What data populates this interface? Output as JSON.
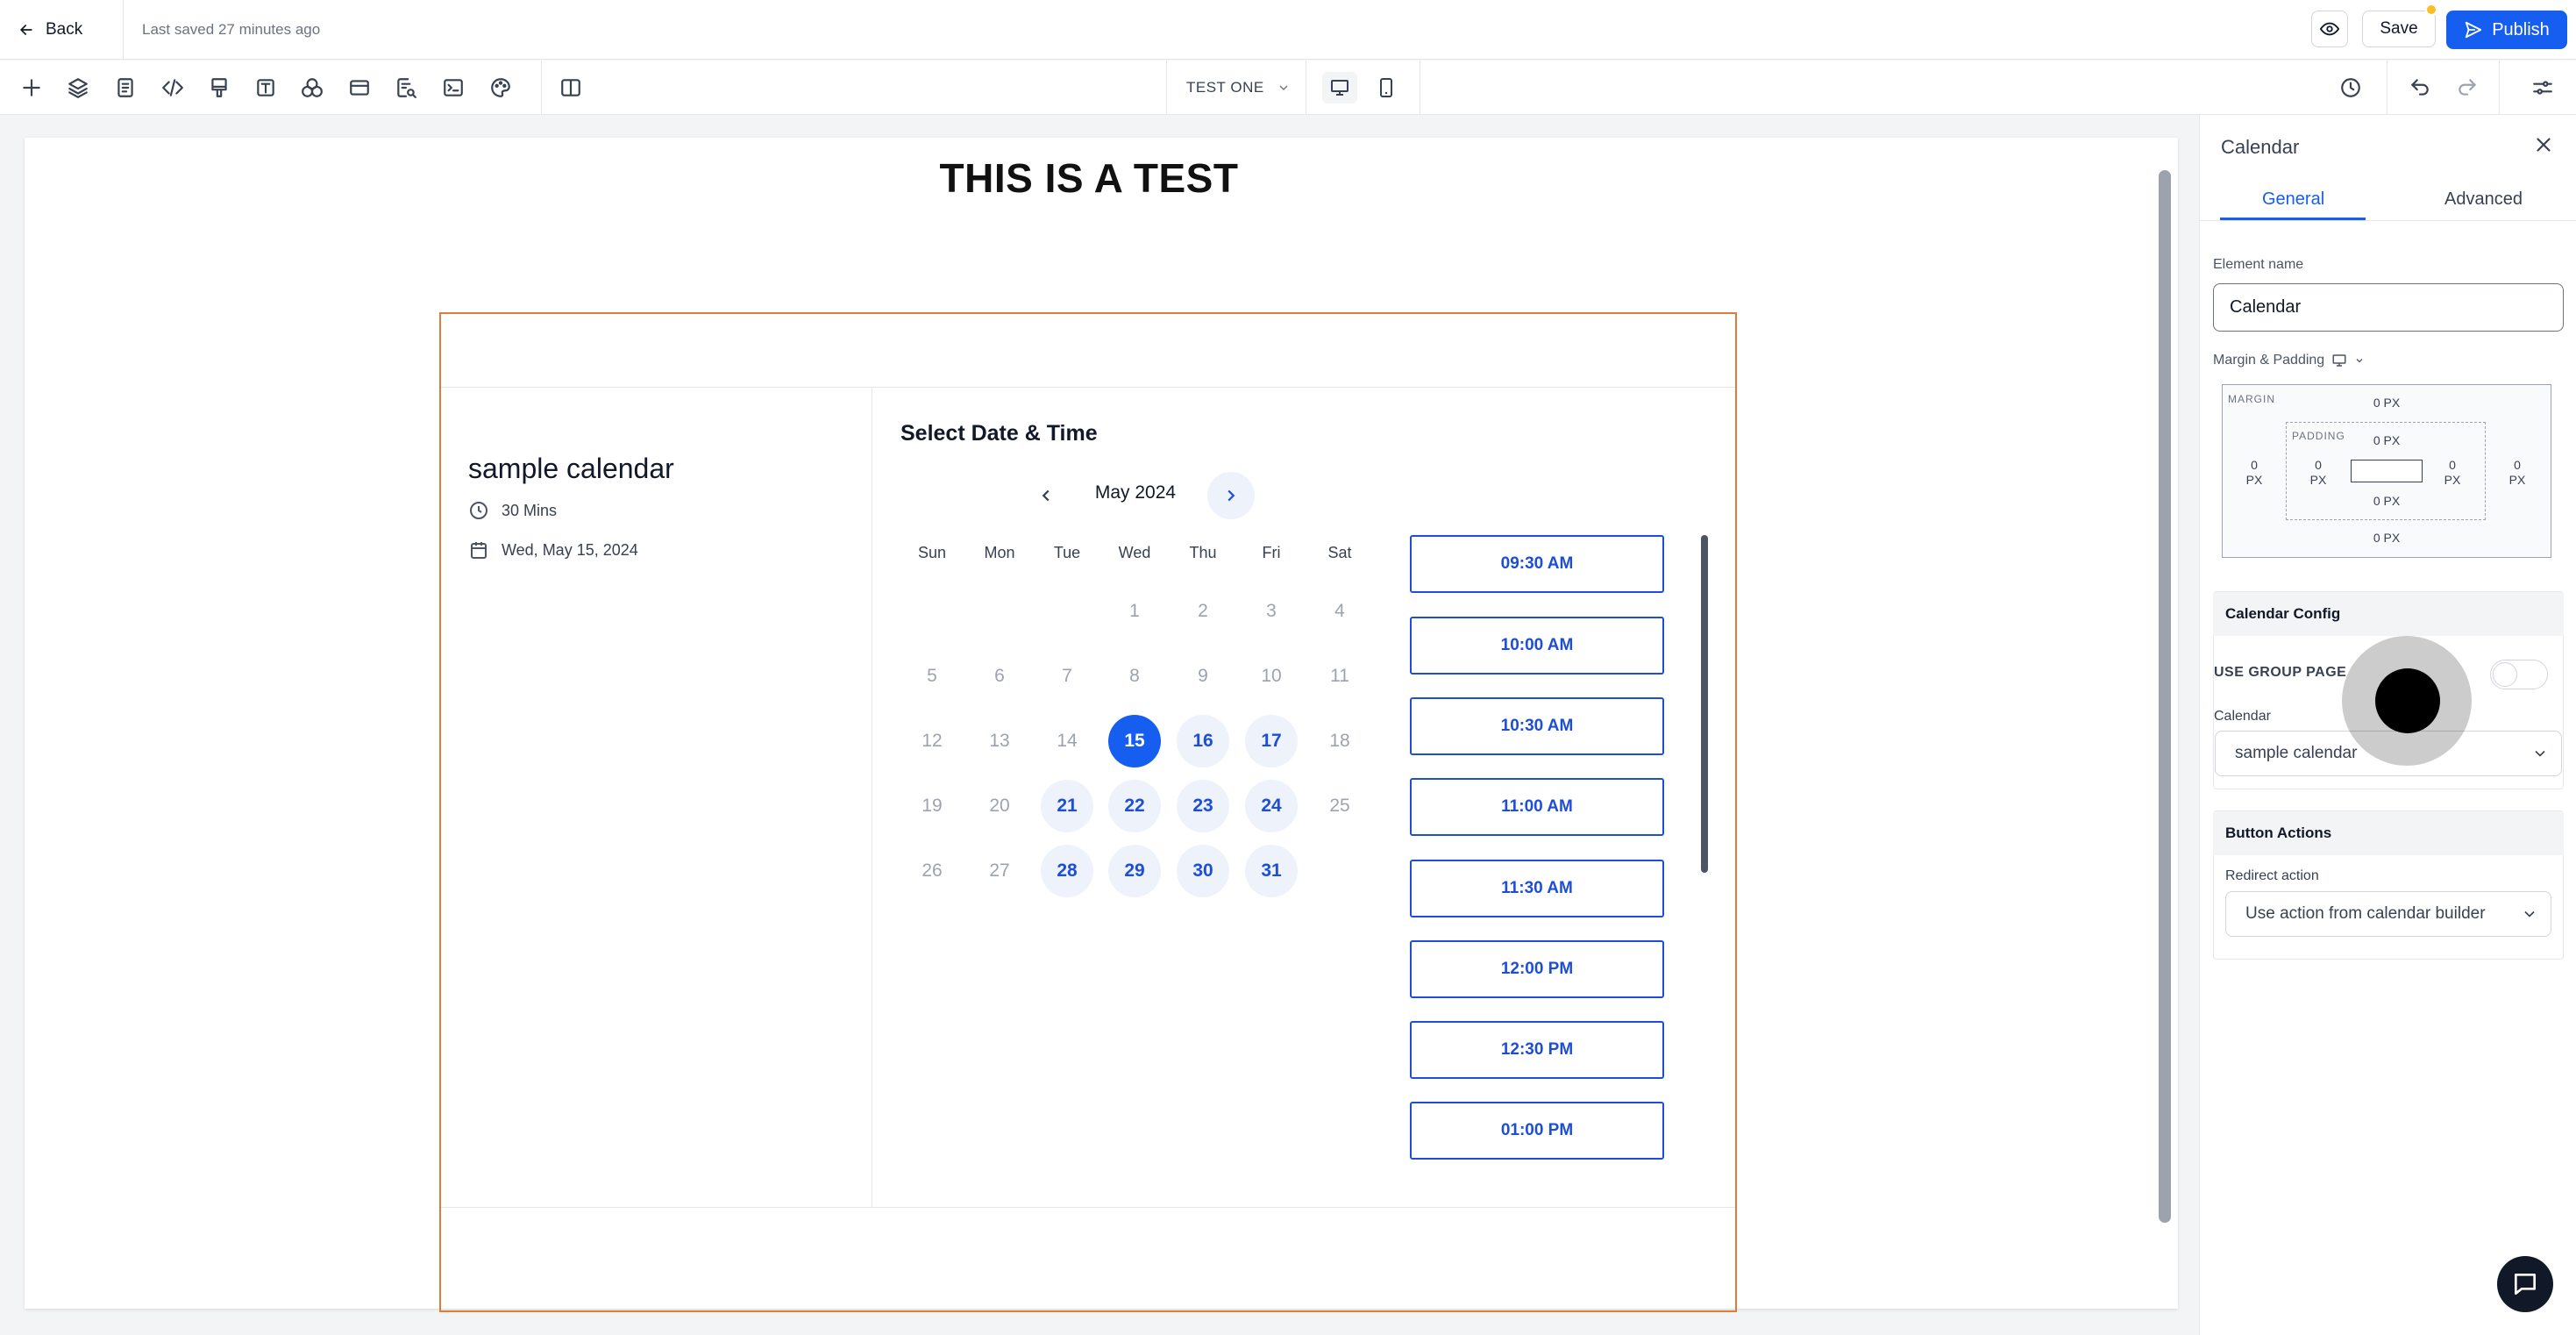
{
  "header": {
    "back_label": "Back",
    "saved_text": "Last saved 27 minutes ago",
    "save_label": "Save",
    "publish_label": "Publish"
  },
  "toolbar": {
    "icons": [
      "plus-icon",
      "layers-icon",
      "pages-icon",
      "code-icon",
      "paint-brush-icon",
      "text-icon",
      "shapes-icon",
      "layout-icon",
      "search-file-icon",
      "terminal-icon",
      "palette-icon",
      "columns-icon"
    ],
    "page_selector": "TEST ONE",
    "right_icons": [
      "history-icon",
      "undo-icon",
      "redo-icon",
      "settings-sliders-icon"
    ]
  },
  "page": {
    "heading": "THIS IS A TEST"
  },
  "calendar": {
    "name": "sample calendar",
    "duration": "30 Mins",
    "date": "Wed, May 15, 2024",
    "select_title": "Select Date & Time",
    "month": "May 2024",
    "weekdays": [
      "Sun",
      "Mon",
      "Tue",
      "Wed",
      "Thu",
      "Fri",
      "Sat"
    ],
    "weeks": [
      [
        "",
        "",
        "",
        "1",
        "2",
        "3",
        "4"
      ],
      [
        "5",
        "6",
        "7",
        "8",
        "9",
        "10",
        "11"
      ],
      [
        "12",
        "13",
        "14",
        "15",
        "16",
        "17",
        "18"
      ],
      [
        "19",
        "20",
        "21",
        "22",
        "23",
        "24",
        "25"
      ],
      [
        "26",
        "27",
        "28",
        "29",
        "30",
        "31",
        ""
      ]
    ],
    "available": [
      "15",
      "16",
      "17",
      "21",
      "22",
      "23",
      "24",
      "28",
      "29",
      "30",
      "31"
    ],
    "selected": "15",
    "slots": [
      "09:30 AM",
      "10:00 AM",
      "10:30 AM",
      "11:00 AM",
      "11:30 AM",
      "12:00 PM",
      "12:30 PM",
      "01:00 PM"
    ],
    "accent": "#155eef"
  },
  "panel": {
    "title": "Calendar",
    "tabs": [
      "General",
      "Advanced"
    ],
    "active_tab": "General",
    "element_name_label": "Element name",
    "element_name_value": "Calendar",
    "margin_padding_label": "Margin & Padding",
    "margin_label": "MARGIN",
    "padding_label": "PADDING",
    "px_value": "0 PX",
    "zero": "0",
    "px": "PX",
    "calendar_config_label": "Calendar Config",
    "use_group_page_label": "USE GROUP PAGE",
    "use_group_page_on": false,
    "calendar_label": "Calendar",
    "calendar_value": "sample calendar",
    "button_actions_label": "Button Actions",
    "redirect_label": "Redirect action",
    "redirect_value": "Use action from calendar builder"
  }
}
